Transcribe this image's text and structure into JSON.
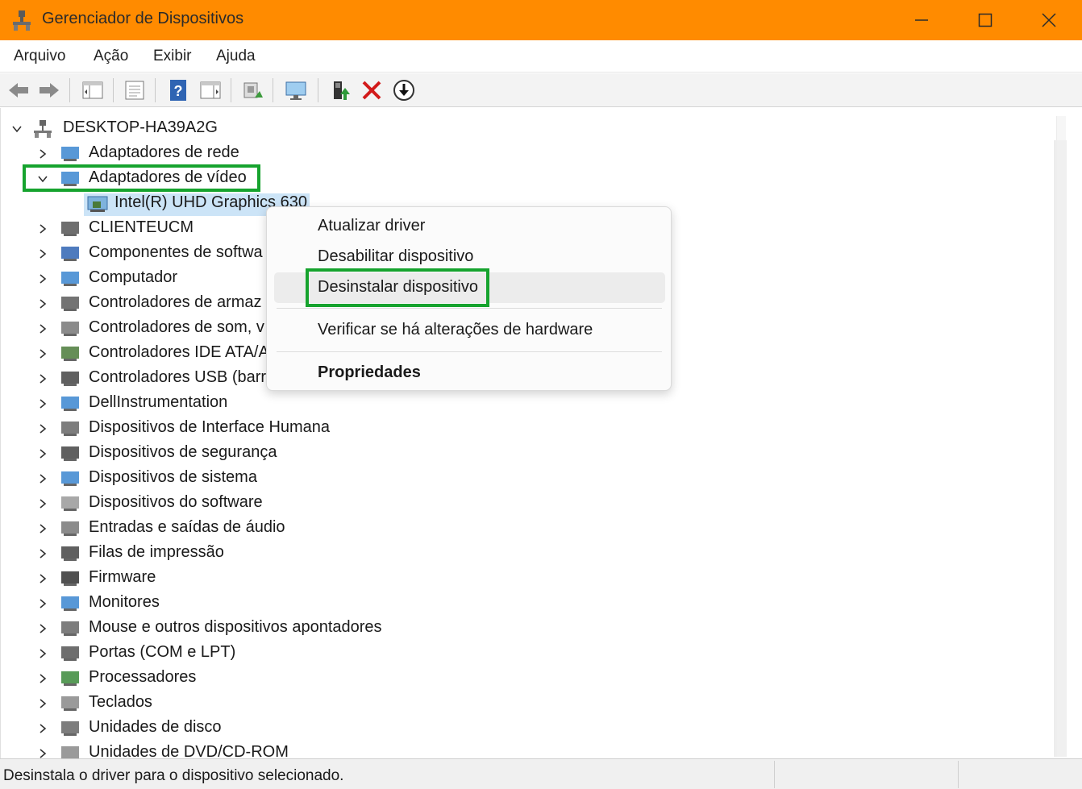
{
  "window": {
    "title": "Gerenciador de Dispositivos",
    "title_bar_color": "#ff8b00"
  },
  "menu": {
    "items": [
      "Arquivo",
      "Ação",
      "Exibir",
      "Ajuda"
    ]
  },
  "toolbar": {
    "buttons": [
      "back-icon",
      "forward-icon",
      "show-hide-console-tree-icon",
      "properties-icon",
      "help-icon",
      "action-pane-icon",
      "scan-hardware-icon",
      "display-monitor-icon",
      "update-driver-icon",
      "uninstall-x-icon",
      "disable-device-icon"
    ]
  },
  "tree": {
    "root": "DESKTOP-HA39A2G",
    "selected_child": "Intel(R) UHD Graphics 630",
    "categories": [
      "Adaptadores de rede",
      "Adaptadores de vídeo",
      "CLIENTEUCM",
      "Componentes de software",
      "Computador",
      "Controladores de armazenamento",
      "Controladores de som, vídeo e jogos",
      "Controladores IDE ATA/ATAPI",
      "Controladores USB (barramento serial universal)",
      "DellInstrumentation",
      "Dispositivos de Interface Humana",
      "Dispositivos de segurança",
      "Dispositivos de sistema",
      "Dispositivos do software",
      "Entradas e saídas de áudio",
      "Filas de impressão",
      "Firmware",
      "Monitores",
      "Mouse e outros dispositivos apontadores",
      "Portas (COM e LPT)",
      "Processadores",
      "Teclados",
      "Unidades de disco",
      "Unidades de DVD/CD-ROM"
    ],
    "visible_labels": {
      "cat0": "Adaptadores de rede",
      "cat1": "Adaptadores de vídeo",
      "cat2": "CLIENTEUCM",
      "cat3": "Componentes de softwa",
      "cat4": "Computador",
      "cat5": "Controladores de armaz",
      "cat6": "Controladores de som, v",
      "cat7": "Controladores IDE ATA/A",
      "cat8": "Controladores USB (barr",
      "cat9": "DellInstrumentation",
      "cat10": "Dispositivos de Interface Humana",
      "cat11": "Dispositivos de segurança",
      "cat12": "Dispositivos de sistema",
      "cat13": "Dispositivos do software",
      "cat14": "Entradas e saídas de áudio",
      "cat15": "Filas de impressão",
      "cat16": "Firmware",
      "cat17": "Monitores",
      "cat18": "Mouse e outros dispositivos apontadores",
      "cat19": "Portas (COM e LPT)",
      "cat20": "Processadores",
      "cat21": "Teclados",
      "cat22": "Unidades de disco",
      "cat23": "Unidades de DVD/CD-ROM"
    }
  },
  "context_menu": {
    "update_driver": "Atualizar driver",
    "disable_device": "Desabilitar dispositivo",
    "uninstall_device": "Desinstalar dispositivo",
    "scan_hardware": "Verificar se há alterações de hardware",
    "properties": "Propriedades",
    "highlight_color": "#16a32e"
  },
  "status": {
    "text": "Desinstala o driver para o dispositivo selecionado."
  }
}
